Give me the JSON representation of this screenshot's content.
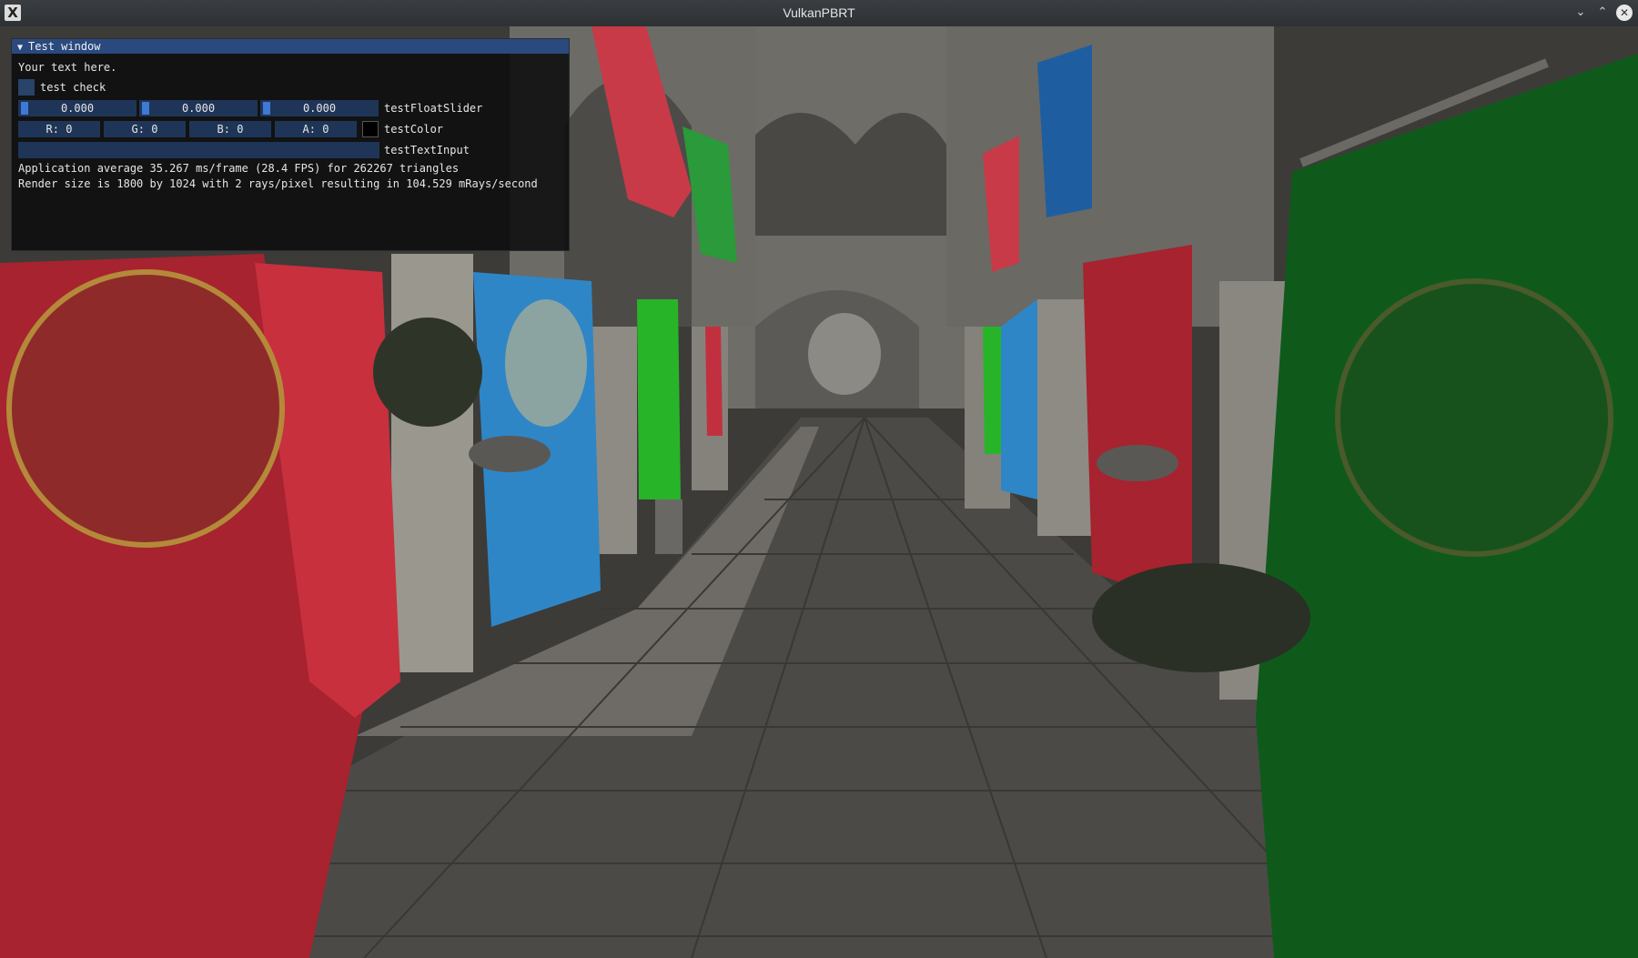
{
  "window": {
    "title": "VulkanPBRT",
    "app_icon": "X",
    "controls": [
      "minimize-icon",
      "maximize-icon",
      "close-icon"
    ]
  },
  "imgui": {
    "title": "Test window",
    "text": "Your text here.",
    "checkbox_label": "test check",
    "checkbox_checked": false,
    "float_slider": {
      "values": [
        "0.000",
        "0.000",
        "0.000"
      ],
      "label": "testFloatSlider"
    },
    "color_edit": {
      "r": "R:  0",
      "g": "G:  0",
      "b": "B:  0",
      "a": "A:  0",
      "label": "testColor",
      "swatch_color": "#000000"
    },
    "text_input": {
      "value": "",
      "label": "testTextInput"
    },
    "stats_line1": "Application average 35.267 ms/frame (28.4 FPS) for 262267 triangles",
    "stats_line2": "Render size is 1800 by 1024 with 2 rays/pixel resulting in 104.529 mRays/second"
  },
  "scene": {
    "description_colors": {
      "banner_red": "#b8283a",
      "banner_blue": "#2e86c8",
      "banner_green": "#0f6b1c",
      "stone": "#8a8782",
      "floor": "#4e4c48"
    }
  }
}
